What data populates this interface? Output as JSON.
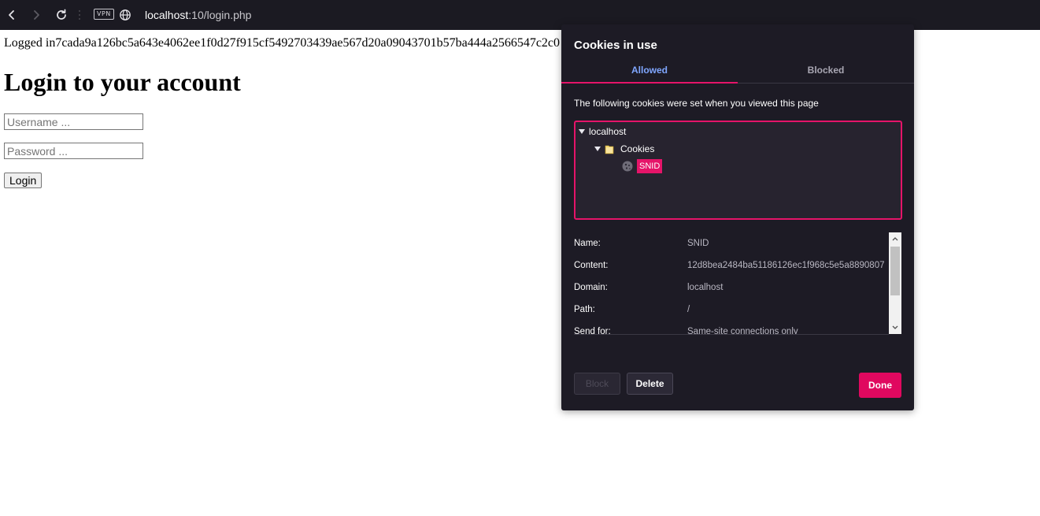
{
  "browser": {
    "vpn_badge": "VPN",
    "url_host": "localhost",
    "url_path": ":10/login.php"
  },
  "page": {
    "logged_in_text": "Logged in7cada9a126bc5a643e4062ee1f0d27f915cf5492703439ae567d20a09043701b57ba444a2566547c2c0",
    "heading": "Login to your account",
    "username_placeholder": "Username ...",
    "password_placeholder": "Password ...",
    "login_button": "Login"
  },
  "cookies_popup": {
    "title": "Cookies in use",
    "tabs": {
      "allowed": "Allowed",
      "blocked": "Blocked"
    },
    "description": "The following cookies were set when you viewed this page",
    "tree": {
      "site": "localhost",
      "folder": "Cookies",
      "cookie": "SNID"
    },
    "details": [
      {
        "key": "Name:",
        "value": "SNID"
      },
      {
        "key": "Content:",
        "value": "12d8bea2484ba51186126ec1f968c5e5a8890807"
      },
      {
        "key": "Domain:",
        "value": "localhost"
      },
      {
        "key": "Path:",
        "value": "/"
      },
      {
        "key": "Send for:",
        "value": "Same-site connections only"
      }
    ],
    "buttons": {
      "block": "Block",
      "delete": "Delete",
      "done": "Done"
    },
    "colors": {
      "accent": "#e51469",
      "tab_active": "#7fa6ff",
      "background": "#1d1b25"
    }
  }
}
